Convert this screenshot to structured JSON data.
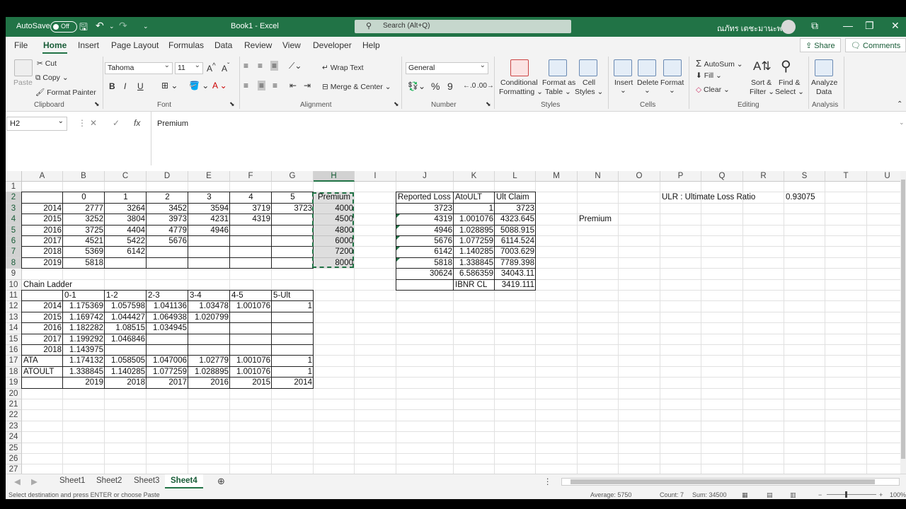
{
  "title_bar": {
    "autosave_label": "AutoSave",
    "autosave_state": "Off",
    "doc_title": "Book1  -  Excel",
    "search_placeholder": "Search (Alt+Q)",
    "user_name": "ณภัทร เตชะมานะพงษ์"
  },
  "menu_tabs": [
    "File",
    "Home",
    "Insert",
    "Page Layout",
    "Formulas",
    "Data",
    "Review",
    "View",
    "Developer",
    "Help"
  ],
  "active_tab": "Home",
  "share_label": "Share",
  "comments_label": "Comments",
  "ribbon": {
    "clipboard": {
      "paste": "Paste",
      "cut": "Cut",
      "copy": "Copy",
      "format_painter": "Format Painter",
      "group": "Clipboard"
    },
    "font": {
      "name": "Tahoma",
      "size": "11",
      "bold": "B",
      "italic": "I",
      "underline": "U",
      "group": "Font"
    },
    "alignment": {
      "wrap_text": "Wrap Text",
      "merge_center": "Merge & Center",
      "group": "Alignment"
    },
    "number": {
      "format": "General",
      "percent": "%",
      "comma": "9",
      "group": "Number"
    },
    "styles": {
      "conditional": "Conditional",
      "conditional2": "Formatting",
      "format_as": "Format as",
      "format_as2": "Table",
      "cell": "Cell",
      "cell2": "Styles",
      "group": "Styles"
    },
    "cells": {
      "insert": "Insert",
      "delete": "Delete",
      "format": "Format",
      "group": "Cells"
    },
    "editing": {
      "autosum": "AutoSum",
      "fill": "Fill",
      "clear": "Clear",
      "sort": "Sort &",
      "sort2": "Filter",
      "find": "Find &",
      "find2": "Select",
      "group": "Editing"
    },
    "analysis": {
      "analyze": "Analyze",
      "analyze2": "Data",
      "group": "Analysis"
    }
  },
  "formula_bar": {
    "name_box": "H2",
    "formula": "Premium",
    "fx": "fx"
  },
  "columns": [
    "A",
    "B",
    "C",
    "D",
    "E",
    "F",
    "G",
    "H",
    "I",
    "J",
    "K",
    "L",
    "M",
    "N",
    "O",
    "P",
    "Q",
    "R",
    "S",
    "T",
    "U"
  ],
  "selected_column": "H",
  "selected_rows": [
    2,
    3,
    4,
    5,
    6,
    7,
    8
  ],
  "rows": [
    1,
    2,
    3,
    4,
    5,
    6,
    7,
    8,
    9,
    10,
    11,
    12,
    13,
    14,
    15,
    16,
    17,
    18,
    19,
    20,
    21,
    22,
    23,
    24,
    25,
    26,
    27
  ],
  "cells": [
    {
      "ref": "B2",
      "v": "0",
      "a": "c"
    },
    {
      "ref": "C2",
      "v": "1",
      "a": "c"
    },
    {
      "ref": "D2",
      "v": "2",
      "a": "c"
    },
    {
      "ref": "E2",
      "v": "3",
      "a": "c"
    },
    {
      "ref": "F2",
      "v": "4",
      "a": "c"
    },
    {
      "ref": "G2",
      "v": "5",
      "a": "c"
    },
    {
      "ref": "H2",
      "v": "Premium",
      "a": "c"
    },
    {
      "ref": "A3",
      "v": "2014",
      "a": "r"
    },
    {
      "ref": "B3",
      "v": "2777",
      "a": "r"
    },
    {
      "ref": "C3",
      "v": "3264",
      "a": "r"
    },
    {
      "ref": "D3",
      "v": "3452",
      "a": "r"
    },
    {
      "ref": "E3",
      "v": "3594",
      "a": "r"
    },
    {
      "ref": "F3",
      "v": "3719",
      "a": "r"
    },
    {
      "ref": "G3",
      "v": "3723",
      "a": "r"
    },
    {
      "ref": "H3",
      "v": "4000",
      "a": "r"
    },
    {
      "ref": "A4",
      "v": "2015",
      "a": "r"
    },
    {
      "ref": "B4",
      "v": "3252",
      "a": "r"
    },
    {
      "ref": "C4",
      "v": "3804",
      "a": "r"
    },
    {
      "ref": "D4",
      "v": "3973",
      "a": "r"
    },
    {
      "ref": "E4",
      "v": "4231",
      "a": "r"
    },
    {
      "ref": "F4",
      "v": "4319",
      "a": "r"
    },
    {
      "ref": "H4",
      "v": "4500",
      "a": "r"
    },
    {
      "ref": "A5",
      "v": "2016",
      "a": "r"
    },
    {
      "ref": "B5",
      "v": "3725",
      "a": "r"
    },
    {
      "ref": "C5",
      "v": "4404",
      "a": "r"
    },
    {
      "ref": "D5",
      "v": "4779",
      "a": "r"
    },
    {
      "ref": "E5",
      "v": "4946",
      "a": "r"
    },
    {
      "ref": "H5",
      "v": "4800",
      "a": "r"
    },
    {
      "ref": "A6",
      "v": "2017",
      "a": "r"
    },
    {
      "ref": "B6",
      "v": "4521",
      "a": "r"
    },
    {
      "ref": "C6",
      "v": "5422",
      "a": "r"
    },
    {
      "ref": "D6",
      "v": "5676",
      "a": "r"
    },
    {
      "ref": "H6",
      "v": "6000",
      "a": "r"
    },
    {
      "ref": "A7",
      "v": "2018",
      "a": "r"
    },
    {
      "ref": "B7",
      "v": "5369",
      "a": "r"
    },
    {
      "ref": "C7",
      "v": "6142",
      "a": "r"
    },
    {
      "ref": "H7",
      "v": "7200",
      "a": "r"
    },
    {
      "ref": "A8",
      "v": "2019",
      "a": "r"
    },
    {
      "ref": "B8",
      "v": "5818",
      "a": "r"
    },
    {
      "ref": "H8",
      "v": "8000",
      "a": "r"
    },
    {
      "ref": "A10",
      "v": "Chain Ladder",
      "a": "l"
    },
    {
      "ref": "B11",
      "v": "0-1",
      "a": "l"
    },
    {
      "ref": "C11",
      "v": "1-2",
      "a": "l"
    },
    {
      "ref": "D11",
      "v": "2-3",
      "a": "l"
    },
    {
      "ref": "E11",
      "v": "3-4",
      "a": "l"
    },
    {
      "ref": "F11",
      "v": "4-5",
      "a": "l"
    },
    {
      "ref": "G11",
      "v": "5-Ult",
      "a": "l"
    },
    {
      "ref": "A12",
      "v": "2014",
      "a": "r"
    },
    {
      "ref": "B12",
      "v": "1.175369",
      "a": "r"
    },
    {
      "ref": "C12",
      "v": "1.057598",
      "a": "r"
    },
    {
      "ref": "D12",
      "v": "1.041136",
      "a": "r"
    },
    {
      "ref": "E12",
      "v": "1.03478",
      "a": "r"
    },
    {
      "ref": "F12",
      "v": "1.001076",
      "a": "r"
    },
    {
      "ref": "G12",
      "v": "1",
      "a": "r"
    },
    {
      "ref": "A13",
      "v": "2015",
      "a": "r"
    },
    {
      "ref": "B13",
      "v": "1.169742",
      "a": "r"
    },
    {
      "ref": "C13",
      "v": "1.044427",
      "a": "r"
    },
    {
      "ref": "D13",
      "v": "1.064938",
      "a": "r"
    },
    {
      "ref": "E13",
      "v": "1.020799",
      "a": "r"
    },
    {
      "ref": "A14",
      "v": "2016",
      "a": "r"
    },
    {
      "ref": "B14",
      "v": "1.182282",
      "a": "r"
    },
    {
      "ref": "C14",
      "v": "1.08515",
      "a": "r"
    },
    {
      "ref": "D14",
      "v": "1.034945",
      "a": "r"
    },
    {
      "ref": "A15",
      "v": "2017",
      "a": "r"
    },
    {
      "ref": "B15",
      "v": "1.199292",
      "a": "r"
    },
    {
      "ref": "C15",
      "v": "1.046846",
      "a": "r"
    },
    {
      "ref": "A16",
      "v": "2018",
      "a": "r"
    },
    {
      "ref": "B16",
      "v": "1.143975",
      "a": "r"
    },
    {
      "ref": "A17",
      "v": "ATA",
      "a": "l"
    },
    {
      "ref": "B17",
      "v": "1.174132",
      "a": "r"
    },
    {
      "ref": "C17",
      "v": "1.058505",
      "a": "r"
    },
    {
      "ref": "D17",
      "v": "1.047006",
      "a": "r"
    },
    {
      "ref": "E17",
      "v": "1.02779",
      "a": "r"
    },
    {
      "ref": "F17",
      "v": "1.001076",
      "a": "r"
    },
    {
      "ref": "G17",
      "v": "1",
      "a": "r"
    },
    {
      "ref": "A18",
      "v": "ATOULT",
      "a": "l"
    },
    {
      "ref": "B18",
      "v": "1.338845",
      "a": "r"
    },
    {
      "ref": "C18",
      "v": "1.140285",
      "a": "r"
    },
    {
      "ref": "D18",
      "v": "1.077259",
      "a": "r"
    },
    {
      "ref": "E18",
      "v": "1.028895",
      "a": "r"
    },
    {
      "ref": "F18",
      "v": "1.001076",
      "a": "r"
    },
    {
      "ref": "G18",
      "v": "1",
      "a": "r"
    },
    {
      "ref": "B19",
      "v": "2019",
      "a": "r"
    },
    {
      "ref": "C19",
      "v": "2018",
      "a": "r"
    },
    {
      "ref": "D19",
      "v": "2017",
      "a": "r"
    },
    {
      "ref": "E19",
      "v": "2016",
      "a": "r"
    },
    {
      "ref": "F19",
      "v": "2015",
      "a": "r"
    },
    {
      "ref": "G19",
      "v": "2014",
      "a": "r"
    },
    {
      "ref": "J2",
      "v": "Reported Loss",
      "a": "l"
    },
    {
      "ref": "K2",
      "v": "AtoULT",
      "a": "l"
    },
    {
      "ref": "L2",
      "v": "Ult Claim",
      "a": "l"
    },
    {
      "ref": "J3",
      "v": "3723",
      "a": "r"
    },
    {
      "ref": "K3",
      "v": "1",
      "a": "r"
    },
    {
      "ref": "L3",
      "v": "3723",
      "a": "r"
    },
    {
      "ref": "J4",
      "v": "4319",
      "a": "r"
    },
    {
      "ref": "K4",
      "v": "1.001076",
      "a": "r"
    },
    {
      "ref": "L4",
      "v": "4323.645",
      "a": "r"
    },
    {
      "ref": "J5",
      "v": "4946",
      "a": "r"
    },
    {
      "ref": "K5",
      "v": "1.028895",
      "a": "r"
    },
    {
      "ref": "L5",
      "v": "5088.915",
      "a": "r"
    },
    {
      "ref": "J6",
      "v": "5676",
      "a": "r"
    },
    {
      "ref": "K6",
      "v": "1.077259",
      "a": "r"
    },
    {
      "ref": "L6",
      "v": "6114.524",
      "a": "r"
    },
    {
      "ref": "J7",
      "v": "6142",
      "a": "r"
    },
    {
      "ref": "K7",
      "v": "1.140285",
      "a": "r"
    },
    {
      "ref": "L7",
      "v": "7003.629",
      "a": "r"
    },
    {
      "ref": "J8",
      "v": "5818",
      "a": "r"
    },
    {
      "ref": "K8",
      "v": "1.338845",
      "a": "r"
    },
    {
      "ref": "L8",
      "v": "7789.398",
      "a": "r"
    },
    {
      "ref": "J9",
      "v": "30624",
      "a": "r"
    },
    {
      "ref": "K9",
      "v": "6.586359",
      "a": "r"
    },
    {
      "ref": "L9",
      "v": "34043.11",
      "a": "r"
    },
    {
      "ref": "K10",
      "v": "IBNR CL",
      "a": "l"
    },
    {
      "ref": "L10",
      "v": "3419.111",
      "a": "r"
    },
    {
      "ref": "N4",
      "v": "Premium",
      "a": "l"
    },
    {
      "ref": "P2",
      "v": "ULR : Ultimate Loss Ratio",
      "a": "l"
    },
    {
      "ref": "S2",
      "v": "0.93075",
      "a": "l"
    }
  ],
  "sheets": [
    "Sheet1",
    "Sheet2",
    "Sheet3",
    "Sheet4"
  ],
  "active_sheet": "Sheet4",
  "status": {
    "message": "Select destination and press ENTER or choose Paste",
    "average": "Average: 5750",
    "count": "Count: 7",
    "sum": "Sum: 34500",
    "zoom": "100%"
  },
  "colors": {
    "excel_green": "#217346",
    "dark_green": "#185c37"
  }
}
